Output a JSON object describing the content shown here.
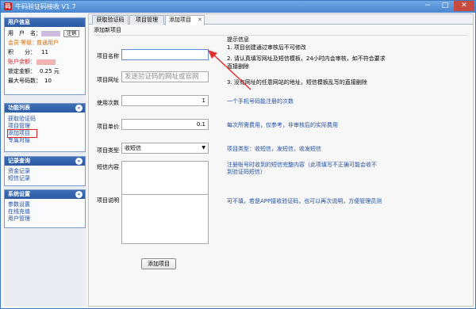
{
  "window": {
    "title": "牛码验证码接收 V1.7",
    "app_icon_glyph": "码",
    "min_glyph": "−",
    "max_glyph": "□",
    "close_glyph": "✕"
  },
  "user_info": {
    "header": "用户信息",
    "username_label": "用　户　名：",
    "logout_button": "注销",
    "member_label": "会员",
    "level_text": "等级：",
    "level_value": "普通用户",
    "points_label": "积　　分：",
    "points_value": "11",
    "balance_label": "账户余额：",
    "frozen_label": "锁定金额：",
    "frozen_value": "0.25 元",
    "max_numbers_label": "最大号码数：",
    "max_numbers_value": "10"
  },
  "function_list": {
    "header": "功能列表",
    "items": [
      "获取验证码",
      "项目管理",
      "添加项目",
      "专属对接"
    ],
    "selected_index": 2
  },
  "records": {
    "header": "记录查询",
    "items": [
      "资金记录",
      "短信记录"
    ]
  },
  "system_settings": {
    "header": "系统设置",
    "items": [
      "参数设置",
      "在线充值",
      "用户管理"
    ]
  },
  "tabs": [
    {
      "label": "获取验证码",
      "active": false
    },
    {
      "label": "项目管理",
      "active": false
    },
    {
      "label": "添加项目",
      "active": true,
      "close": "✕"
    }
  ],
  "form": {
    "section_title": "添加新项目",
    "project_name_label": "项目名称",
    "project_name_value": "",
    "project_url_label": "项目网址",
    "project_url_placeholder": "发送验证码的网址或官网",
    "uses_label": "使用次数",
    "uses_value": "1",
    "price_label": "项目单价",
    "price_value": "0.1",
    "type_label": "项目类型",
    "type_value": "收短信",
    "sms_content_label": "短信内容",
    "description_label": "项目说明",
    "submit_button": "添加项目"
  },
  "tips": {
    "title": "提示信息",
    "lines": [
      "1. 项目创建通过审核后不可修改",
      "2. 请认真填写网址及短信模板，24小时内会审核，如不符合要求",
      "直接删除",
      "3. 没有网址的任意网站的地址，短信模板乱写的直接删除"
    ],
    "uses_hint": "一个手机号码能注册的次数",
    "price_hint": "每次所需费用，仅参考，非审核后的实际费用",
    "type_hint": "项目类型：收短信，发短信，收发短信",
    "sms_hint_1": "注册账号时收到的短信完整内容（此项填写不正确可能会收不",
    "sms_hint_2": "到验证码短信）",
    "desc_hint": "可不填，若是APP接收验证码，也可以再次说明，方便管理员测"
  },
  "colors": {
    "accent_blue": "#2b5aa4",
    "link_blue": "#1f4ea3",
    "highlight_red": "#e02020",
    "arrow_red": "#e03030"
  }
}
